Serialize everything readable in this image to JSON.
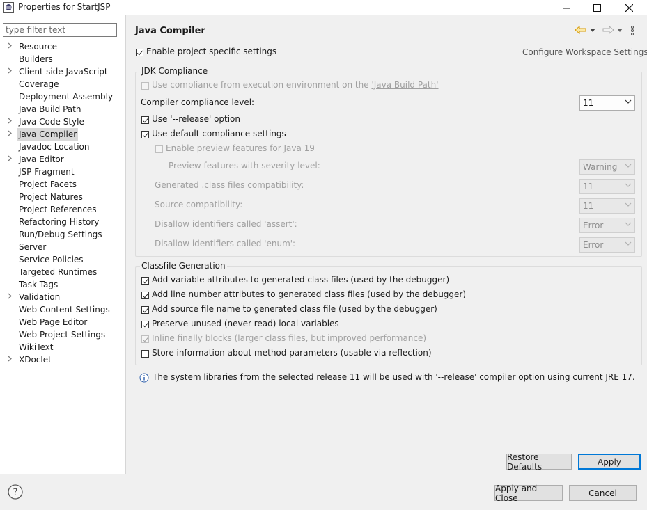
{
  "window": {
    "title": "Properties for StartJSP"
  },
  "filter": {
    "placeholder": "type filter text"
  },
  "tree": [
    {
      "label": "Resource",
      "expandable": true
    },
    {
      "label": "Builders",
      "expandable": false
    },
    {
      "label": "Client-side JavaScript",
      "expandable": true
    },
    {
      "label": "Coverage",
      "expandable": false
    },
    {
      "label": "Deployment Assembly",
      "expandable": false
    },
    {
      "label": "Java Build Path",
      "expandable": false
    },
    {
      "label": "Java Code Style",
      "expandable": true
    },
    {
      "label": "Java Compiler",
      "expandable": true,
      "selected": true
    },
    {
      "label": "Javadoc Location",
      "expandable": false
    },
    {
      "label": "Java Editor",
      "expandable": true
    },
    {
      "label": "JSP Fragment",
      "expandable": false
    },
    {
      "label": "Project Facets",
      "expandable": false
    },
    {
      "label": "Project Natures",
      "expandable": false
    },
    {
      "label": "Project References",
      "expandable": false
    },
    {
      "label": "Refactoring History",
      "expandable": false
    },
    {
      "label": "Run/Debug Settings",
      "expandable": false
    },
    {
      "label": "Server",
      "expandable": false
    },
    {
      "label": "Service Policies",
      "expandable": false
    },
    {
      "label": "Targeted Runtimes",
      "expandable": false
    },
    {
      "label": "Task Tags",
      "expandable": false
    },
    {
      "label": "Validation",
      "expandable": true
    },
    {
      "label": "Web Content Settings",
      "expandable": false
    },
    {
      "label": "Web Page Editor",
      "expandable": false
    },
    {
      "label": "Web Project Settings",
      "expandable": false
    },
    {
      "label": "WikiText",
      "expandable": false
    },
    {
      "label": "XDoclet",
      "expandable": true
    }
  ],
  "page": {
    "title": "Java Compiler",
    "enable_specific": "Enable project specific settings",
    "configure_link": "Configure Workspace Settings...",
    "jdk": {
      "group_title": "JDK Compliance",
      "use_compliance_prefix": "Use compliance from execution environment on the ",
      "use_compliance_link": "'Java Build Path'",
      "compliance_level_label": "Compiler compliance level:",
      "compliance_level_value": "11",
      "release_option": "Use '--release' option",
      "use_default": "Use default compliance settings",
      "enable_preview": "Enable preview features for Java 19",
      "preview_severity_label": "Preview features with severity level:",
      "preview_severity_value": "Warning",
      "generated_class_label": "Generated .class files compatibility:",
      "generated_class_value": "11",
      "source_compat_label": "Source compatibility:",
      "source_compat_value": "11",
      "assert_label": "Disallow identifiers called 'assert':",
      "assert_value": "Error",
      "enum_label": "Disallow identifiers called 'enum':",
      "enum_value": "Error"
    },
    "classfile": {
      "group_title": "Classfile Generation",
      "items": [
        {
          "label": "Add variable attributes to generated class files (used by the debugger)",
          "checked": true,
          "disabled": false
        },
        {
          "label": "Add line number attributes to generated class files (used by the debugger)",
          "checked": true,
          "disabled": false
        },
        {
          "label": "Add source file name to generated class file (used by the debugger)",
          "checked": true,
          "disabled": false
        },
        {
          "label": "Preserve unused (never read) local variables",
          "checked": true,
          "disabled": false
        },
        {
          "label": "Inline finally blocks (larger class files, but improved performance)",
          "checked": true,
          "disabled": true
        },
        {
          "label": "Store information about method parameters (usable via reflection)",
          "checked": false,
          "disabled": false
        }
      ]
    },
    "info_message": "The system libraries from the selected release 11 will be used with '--release' compiler option using current JRE 17.",
    "restore_defaults": "Restore Defaults",
    "apply": "Apply"
  },
  "footer": {
    "apply_close": "Apply and Close",
    "cancel": "Cancel"
  },
  "colors": {
    "accent": "#0078d7",
    "nav_arrow": "#e8a200"
  }
}
